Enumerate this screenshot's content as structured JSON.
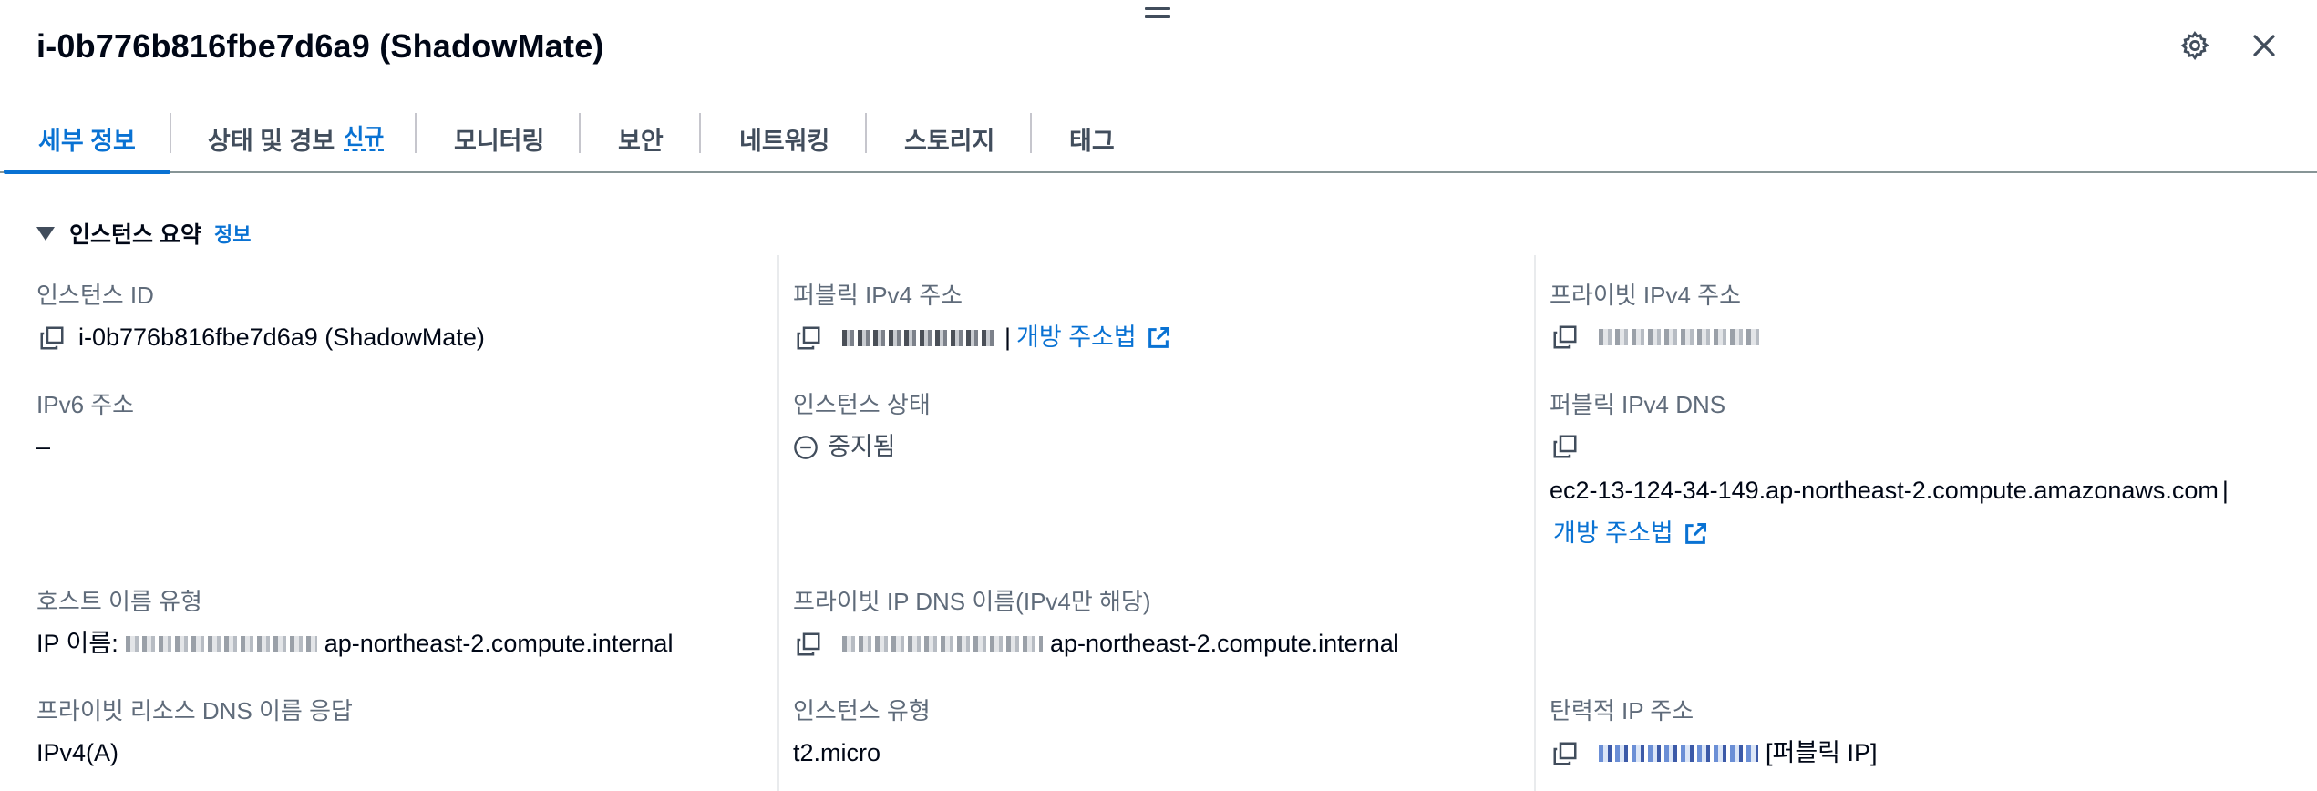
{
  "header": {
    "title": "i-0b776b816fbe7d6a9 (ShadowMate)",
    "settings_icon": "gear-icon",
    "close_icon": "close-icon"
  },
  "tabs": [
    {
      "label": "세부 정보",
      "active": true
    },
    {
      "label": "상태 및 경보",
      "badge": "신규"
    },
    {
      "label": "모니터링"
    },
    {
      "label": "보안"
    },
    {
      "label": "네트워킹"
    },
    {
      "label": "스토리지"
    },
    {
      "label": "태그"
    }
  ],
  "section": {
    "title": "인스턴스 요약",
    "info_link": "정보"
  },
  "fields": {
    "instance_id": {
      "label": "인스턴스 ID",
      "value": "i-0b776b816fbe7d6a9 (ShadowMate)"
    },
    "public_ipv4": {
      "label": "퍼블릭 IPv4 주소",
      "separator": "|",
      "link": "개방 주소법"
    },
    "private_ipv4": {
      "label": "프라이빗 IPv4 주소"
    },
    "ipv6": {
      "label": "IPv6 주소",
      "value": "–"
    },
    "instance_state": {
      "label": "인스턴스 상태",
      "value": "중지됨"
    },
    "public_ipv4_dns": {
      "label": "퍼블릭 IPv4 DNS",
      "value": "ec2-13-124-34-149.ap-northeast-2.compute.amazonaws.com",
      "separator": "|",
      "link": "개방 주소법"
    },
    "hostname_type": {
      "label": "호스트 이름 유형",
      "prefix": "IP 이름:",
      "suffix": "ap-northeast-2.compute.internal"
    },
    "private_ip_dns": {
      "label": "프라이빗 IP DNS 이름(IPv4만 해당)",
      "suffix": "ap-northeast-2.compute.internal"
    },
    "resource_dns": {
      "label": "프라이빗 리소스 DNS 이름 응답",
      "value": "IPv4(A)"
    },
    "instance_type": {
      "label": "인스턴스 유형",
      "value": "t2.micro"
    },
    "elastic_ip": {
      "label": "탄력적 IP 주소",
      "suffix": "[퍼블릭 IP]"
    }
  },
  "icons": {
    "copy": "copy-icon",
    "external": "external-link-icon",
    "stopped": "stopped-status-icon",
    "caret": "caret-down-icon"
  },
  "colors": {
    "accent": "#0972d3",
    "text": "#000716",
    "label": "#5f6b7a"
  }
}
